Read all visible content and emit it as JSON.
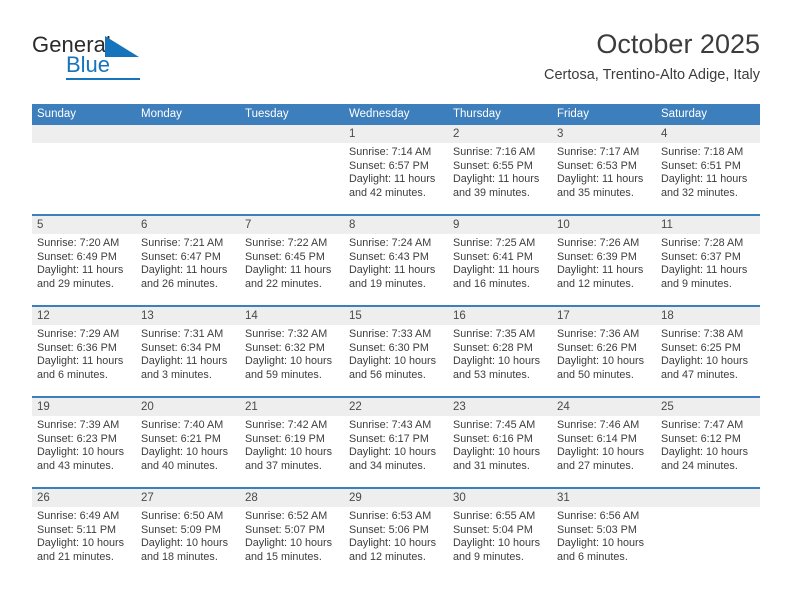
{
  "brand": {
    "name_part1": "General",
    "name_part2": "Blue",
    "accent_color": "#1574bb"
  },
  "header": {
    "title": "October 2025",
    "subtitle": "Certosa, Trentino-Alto Adige, Italy"
  },
  "theme": {
    "header_blue": "#3d7ebc",
    "daynum_strip": "#eeeeee",
    "text": "#3d3d3d"
  },
  "weekday_headers": [
    "Sunday",
    "Monday",
    "Tuesday",
    "Wednesday",
    "Thursday",
    "Friday",
    "Saturday"
  ],
  "weeks": [
    [
      {
        "day": "",
        "lines": []
      },
      {
        "day": "",
        "lines": []
      },
      {
        "day": "",
        "lines": []
      },
      {
        "day": "1",
        "lines": [
          "Sunrise: 7:14 AM",
          "Sunset: 6:57 PM",
          "Daylight: 11 hours",
          "and 42 minutes."
        ]
      },
      {
        "day": "2",
        "lines": [
          "Sunrise: 7:16 AM",
          "Sunset: 6:55 PM",
          "Daylight: 11 hours",
          "and 39 minutes."
        ]
      },
      {
        "day": "3",
        "lines": [
          "Sunrise: 7:17 AM",
          "Sunset: 6:53 PM",
          "Daylight: 11 hours",
          "and 35 minutes."
        ]
      },
      {
        "day": "4",
        "lines": [
          "Sunrise: 7:18 AM",
          "Sunset: 6:51 PM",
          "Daylight: 11 hours",
          "and 32 minutes."
        ]
      }
    ],
    [
      {
        "day": "5",
        "lines": [
          "Sunrise: 7:20 AM",
          "Sunset: 6:49 PM",
          "Daylight: 11 hours",
          "and 29 minutes."
        ]
      },
      {
        "day": "6",
        "lines": [
          "Sunrise: 7:21 AM",
          "Sunset: 6:47 PM",
          "Daylight: 11 hours",
          "and 26 minutes."
        ]
      },
      {
        "day": "7",
        "lines": [
          "Sunrise: 7:22 AM",
          "Sunset: 6:45 PM",
          "Daylight: 11 hours",
          "and 22 minutes."
        ]
      },
      {
        "day": "8",
        "lines": [
          "Sunrise: 7:24 AM",
          "Sunset: 6:43 PM",
          "Daylight: 11 hours",
          "and 19 minutes."
        ]
      },
      {
        "day": "9",
        "lines": [
          "Sunrise: 7:25 AM",
          "Sunset: 6:41 PM",
          "Daylight: 11 hours",
          "and 16 minutes."
        ]
      },
      {
        "day": "10",
        "lines": [
          "Sunrise: 7:26 AM",
          "Sunset: 6:39 PM",
          "Daylight: 11 hours",
          "and 12 minutes."
        ]
      },
      {
        "day": "11",
        "lines": [
          "Sunrise: 7:28 AM",
          "Sunset: 6:37 PM",
          "Daylight: 11 hours",
          "and 9 minutes."
        ]
      }
    ],
    [
      {
        "day": "12",
        "lines": [
          "Sunrise: 7:29 AM",
          "Sunset: 6:36 PM",
          "Daylight: 11 hours",
          "and 6 minutes."
        ]
      },
      {
        "day": "13",
        "lines": [
          "Sunrise: 7:31 AM",
          "Sunset: 6:34 PM",
          "Daylight: 11 hours",
          "and 3 minutes."
        ]
      },
      {
        "day": "14",
        "lines": [
          "Sunrise: 7:32 AM",
          "Sunset: 6:32 PM",
          "Daylight: 10 hours",
          "and 59 minutes."
        ]
      },
      {
        "day": "15",
        "lines": [
          "Sunrise: 7:33 AM",
          "Sunset: 6:30 PM",
          "Daylight: 10 hours",
          "and 56 minutes."
        ]
      },
      {
        "day": "16",
        "lines": [
          "Sunrise: 7:35 AM",
          "Sunset: 6:28 PM",
          "Daylight: 10 hours",
          "and 53 minutes."
        ]
      },
      {
        "day": "17",
        "lines": [
          "Sunrise: 7:36 AM",
          "Sunset: 6:26 PM",
          "Daylight: 10 hours",
          "and 50 minutes."
        ]
      },
      {
        "day": "18",
        "lines": [
          "Sunrise: 7:38 AM",
          "Sunset: 6:25 PM",
          "Daylight: 10 hours",
          "and 47 minutes."
        ]
      }
    ],
    [
      {
        "day": "19",
        "lines": [
          "Sunrise: 7:39 AM",
          "Sunset: 6:23 PM",
          "Daylight: 10 hours",
          "and 43 minutes."
        ]
      },
      {
        "day": "20",
        "lines": [
          "Sunrise: 7:40 AM",
          "Sunset: 6:21 PM",
          "Daylight: 10 hours",
          "and 40 minutes."
        ]
      },
      {
        "day": "21",
        "lines": [
          "Sunrise: 7:42 AM",
          "Sunset: 6:19 PM",
          "Daylight: 10 hours",
          "and 37 minutes."
        ]
      },
      {
        "day": "22",
        "lines": [
          "Sunrise: 7:43 AM",
          "Sunset: 6:17 PM",
          "Daylight: 10 hours",
          "and 34 minutes."
        ]
      },
      {
        "day": "23",
        "lines": [
          "Sunrise: 7:45 AM",
          "Sunset: 6:16 PM",
          "Daylight: 10 hours",
          "and 31 minutes."
        ]
      },
      {
        "day": "24",
        "lines": [
          "Sunrise: 7:46 AM",
          "Sunset: 6:14 PM",
          "Daylight: 10 hours",
          "and 27 minutes."
        ]
      },
      {
        "day": "25",
        "lines": [
          "Sunrise: 7:47 AM",
          "Sunset: 6:12 PM",
          "Daylight: 10 hours",
          "and 24 minutes."
        ]
      }
    ],
    [
      {
        "day": "26",
        "lines": [
          "Sunrise: 6:49 AM",
          "Sunset: 5:11 PM",
          "Daylight: 10 hours",
          "and 21 minutes."
        ]
      },
      {
        "day": "27",
        "lines": [
          "Sunrise: 6:50 AM",
          "Sunset: 5:09 PM",
          "Daylight: 10 hours",
          "and 18 minutes."
        ]
      },
      {
        "day": "28",
        "lines": [
          "Sunrise: 6:52 AM",
          "Sunset: 5:07 PM",
          "Daylight: 10 hours",
          "and 15 minutes."
        ]
      },
      {
        "day": "29",
        "lines": [
          "Sunrise: 6:53 AM",
          "Sunset: 5:06 PM",
          "Daylight: 10 hours",
          "and 12 minutes."
        ]
      },
      {
        "day": "30",
        "lines": [
          "Sunrise: 6:55 AM",
          "Sunset: 5:04 PM",
          "Daylight: 10 hours",
          "and 9 minutes."
        ]
      },
      {
        "day": "31",
        "lines": [
          "Sunrise: 6:56 AM",
          "Sunset: 5:03 PM",
          "Daylight: 10 hours",
          "and 6 minutes."
        ]
      },
      {
        "day": "",
        "lines": []
      }
    ]
  ]
}
